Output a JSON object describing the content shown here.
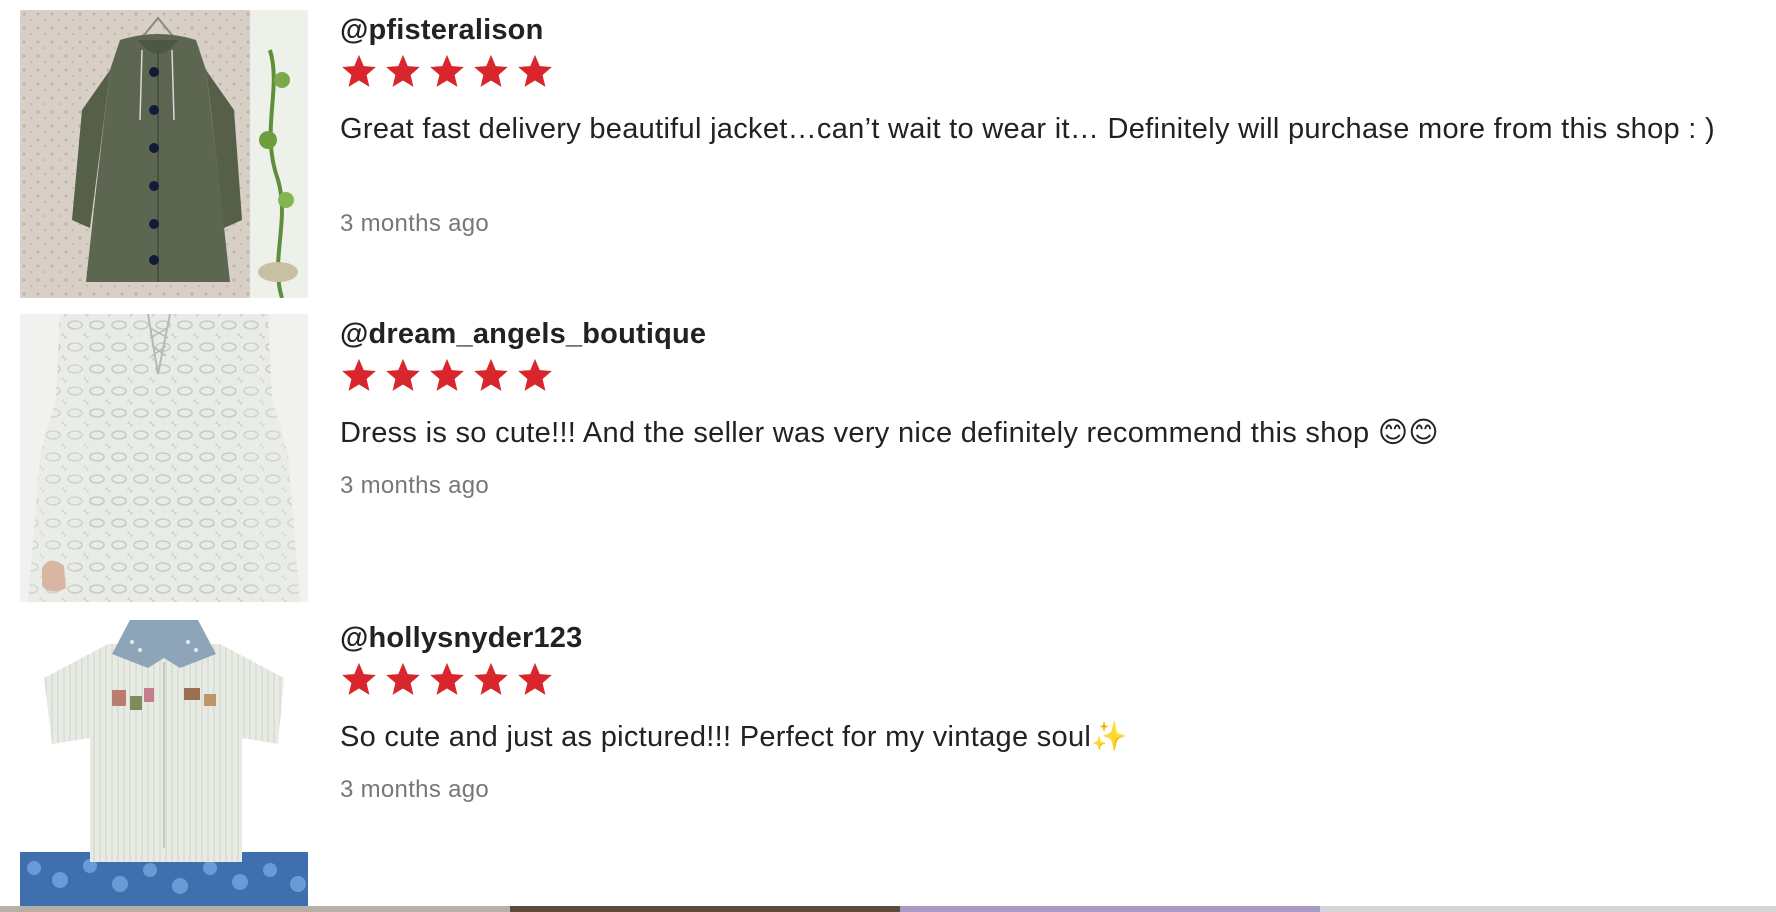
{
  "reviews": [
    {
      "username": "@pfisteralison",
      "rating": 5,
      "comment": "Great fast delivery beautiful jacket…can’t wait to wear it… Definitely will purchase more from this shop : )",
      "time": "3 months ago",
      "thumb_icon": "green-hooded-jacket-photo"
    },
    {
      "username": "@dream_angels_boutique",
      "rating": 5,
      "comment": "Dress is so cute!!! And the seller was very nice definitely recommend this shop 😊😊",
      "time": "3 months ago",
      "thumb_icon": "white-lace-dress-photo"
    },
    {
      "username": "@hollysnyder123",
      "rating": 5,
      "comment": "So cute and just as pictured!!! Perfect for my vintage soul✨",
      "time": "3 months ago",
      "thumb_icon": "embroidered-striped-shirt-photo"
    }
  ],
  "colors": {
    "star": "#d9262c",
    "username": "#222222",
    "time": "#777777"
  }
}
